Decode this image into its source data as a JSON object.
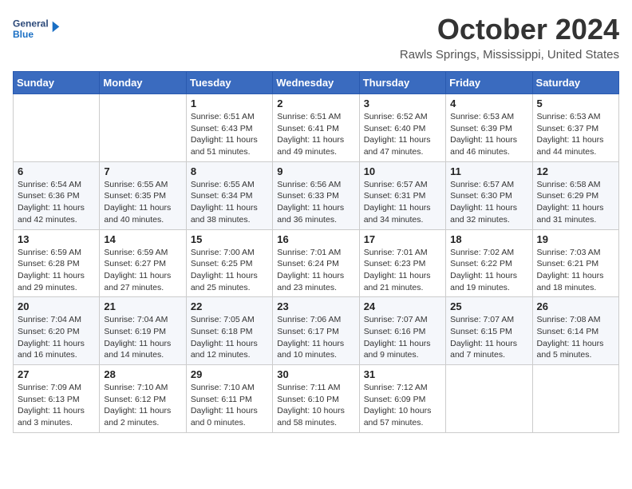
{
  "logo": {
    "line1": "General",
    "line2": "Blue"
  },
  "title": "October 2024",
  "location": "Rawls Springs, Mississippi, United States",
  "weekdays": [
    "Sunday",
    "Monday",
    "Tuesday",
    "Wednesday",
    "Thursday",
    "Friday",
    "Saturday"
  ],
  "weeks": [
    [
      {
        "num": "",
        "detail": ""
      },
      {
        "num": "",
        "detail": ""
      },
      {
        "num": "1",
        "detail": "Sunrise: 6:51 AM\nSunset: 6:43 PM\nDaylight: 11 hours and 51 minutes."
      },
      {
        "num": "2",
        "detail": "Sunrise: 6:51 AM\nSunset: 6:41 PM\nDaylight: 11 hours and 49 minutes."
      },
      {
        "num": "3",
        "detail": "Sunrise: 6:52 AM\nSunset: 6:40 PM\nDaylight: 11 hours and 47 minutes."
      },
      {
        "num": "4",
        "detail": "Sunrise: 6:53 AM\nSunset: 6:39 PM\nDaylight: 11 hours and 46 minutes."
      },
      {
        "num": "5",
        "detail": "Sunrise: 6:53 AM\nSunset: 6:37 PM\nDaylight: 11 hours and 44 minutes."
      }
    ],
    [
      {
        "num": "6",
        "detail": "Sunrise: 6:54 AM\nSunset: 6:36 PM\nDaylight: 11 hours and 42 minutes."
      },
      {
        "num": "7",
        "detail": "Sunrise: 6:55 AM\nSunset: 6:35 PM\nDaylight: 11 hours and 40 minutes."
      },
      {
        "num": "8",
        "detail": "Sunrise: 6:55 AM\nSunset: 6:34 PM\nDaylight: 11 hours and 38 minutes."
      },
      {
        "num": "9",
        "detail": "Sunrise: 6:56 AM\nSunset: 6:33 PM\nDaylight: 11 hours and 36 minutes."
      },
      {
        "num": "10",
        "detail": "Sunrise: 6:57 AM\nSunset: 6:31 PM\nDaylight: 11 hours and 34 minutes."
      },
      {
        "num": "11",
        "detail": "Sunrise: 6:57 AM\nSunset: 6:30 PM\nDaylight: 11 hours and 32 minutes."
      },
      {
        "num": "12",
        "detail": "Sunrise: 6:58 AM\nSunset: 6:29 PM\nDaylight: 11 hours and 31 minutes."
      }
    ],
    [
      {
        "num": "13",
        "detail": "Sunrise: 6:59 AM\nSunset: 6:28 PM\nDaylight: 11 hours and 29 minutes."
      },
      {
        "num": "14",
        "detail": "Sunrise: 6:59 AM\nSunset: 6:27 PM\nDaylight: 11 hours and 27 minutes."
      },
      {
        "num": "15",
        "detail": "Sunrise: 7:00 AM\nSunset: 6:25 PM\nDaylight: 11 hours and 25 minutes."
      },
      {
        "num": "16",
        "detail": "Sunrise: 7:01 AM\nSunset: 6:24 PM\nDaylight: 11 hours and 23 minutes."
      },
      {
        "num": "17",
        "detail": "Sunrise: 7:01 AM\nSunset: 6:23 PM\nDaylight: 11 hours and 21 minutes."
      },
      {
        "num": "18",
        "detail": "Sunrise: 7:02 AM\nSunset: 6:22 PM\nDaylight: 11 hours and 19 minutes."
      },
      {
        "num": "19",
        "detail": "Sunrise: 7:03 AM\nSunset: 6:21 PM\nDaylight: 11 hours and 18 minutes."
      }
    ],
    [
      {
        "num": "20",
        "detail": "Sunrise: 7:04 AM\nSunset: 6:20 PM\nDaylight: 11 hours and 16 minutes."
      },
      {
        "num": "21",
        "detail": "Sunrise: 7:04 AM\nSunset: 6:19 PM\nDaylight: 11 hours and 14 minutes."
      },
      {
        "num": "22",
        "detail": "Sunrise: 7:05 AM\nSunset: 6:18 PM\nDaylight: 11 hours and 12 minutes."
      },
      {
        "num": "23",
        "detail": "Sunrise: 7:06 AM\nSunset: 6:17 PM\nDaylight: 11 hours and 10 minutes."
      },
      {
        "num": "24",
        "detail": "Sunrise: 7:07 AM\nSunset: 6:16 PM\nDaylight: 11 hours and 9 minutes."
      },
      {
        "num": "25",
        "detail": "Sunrise: 7:07 AM\nSunset: 6:15 PM\nDaylight: 11 hours and 7 minutes."
      },
      {
        "num": "26",
        "detail": "Sunrise: 7:08 AM\nSunset: 6:14 PM\nDaylight: 11 hours and 5 minutes."
      }
    ],
    [
      {
        "num": "27",
        "detail": "Sunrise: 7:09 AM\nSunset: 6:13 PM\nDaylight: 11 hours and 3 minutes."
      },
      {
        "num": "28",
        "detail": "Sunrise: 7:10 AM\nSunset: 6:12 PM\nDaylight: 11 hours and 2 minutes."
      },
      {
        "num": "29",
        "detail": "Sunrise: 7:10 AM\nSunset: 6:11 PM\nDaylight: 11 hours and 0 minutes."
      },
      {
        "num": "30",
        "detail": "Sunrise: 7:11 AM\nSunset: 6:10 PM\nDaylight: 10 hours and 58 minutes."
      },
      {
        "num": "31",
        "detail": "Sunrise: 7:12 AM\nSunset: 6:09 PM\nDaylight: 10 hours and 57 minutes."
      },
      {
        "num": "",
        "detail": ""
      },
      {
        "num": "",
        "detail": ""
      }
    ]
  ]
}
